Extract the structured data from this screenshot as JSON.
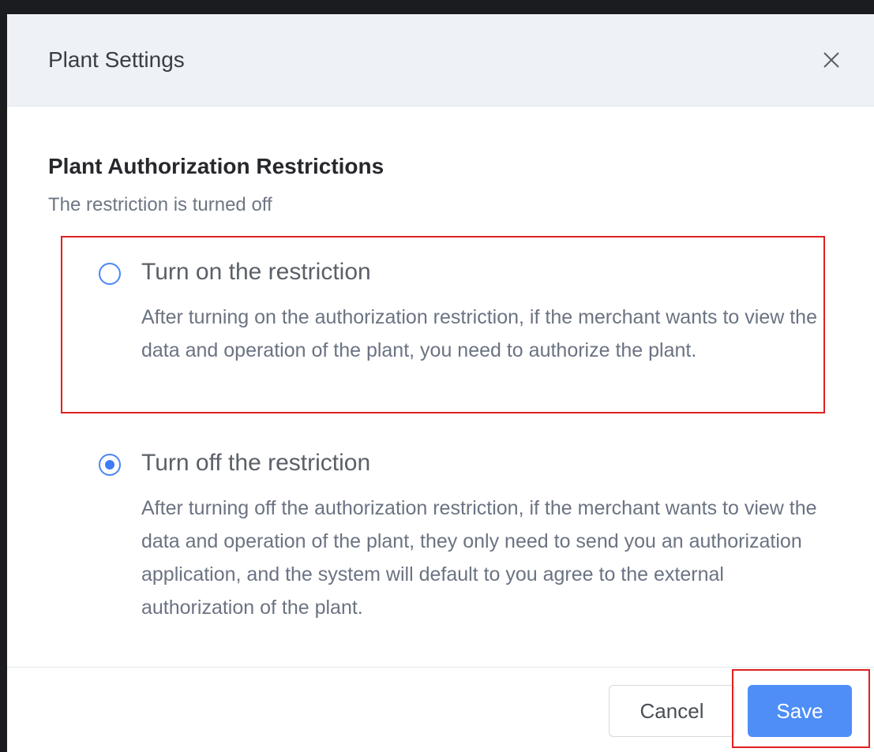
{
  "dialog": {
    "title": "Plant Settings",
    "close_icon": "close-icon"
  },
  "section": {
    "title": "Plant Authorization Restrictions",
    "status": "The restriction is turned off"
  },
  "options": [
    {
      "label": "Turn on the restriction",
      "description": "After turning on the authorization restriction, if the merchant wants to view the data and operation of the plant, you need to authorize the plant.",
      "selected": false
    },
    {
      "label": "Turn off the restriction",
      "description": "After turning off the authorization restriction, if the merchant wants to view the data and operation of the plant, they only need to send you an authorization application, and the system will default to you agree to the external authorization of the plant.",
      "selected": true
    }
  ],
  "footer": {
    "cancel_label": "Cancel",
    "save_label": "Save"
  },
  "colors": {
    "accent": "#4f8ef7",
    "highlight": "#e02020",
    "header_bg": "#eef1f5"
  }
}
